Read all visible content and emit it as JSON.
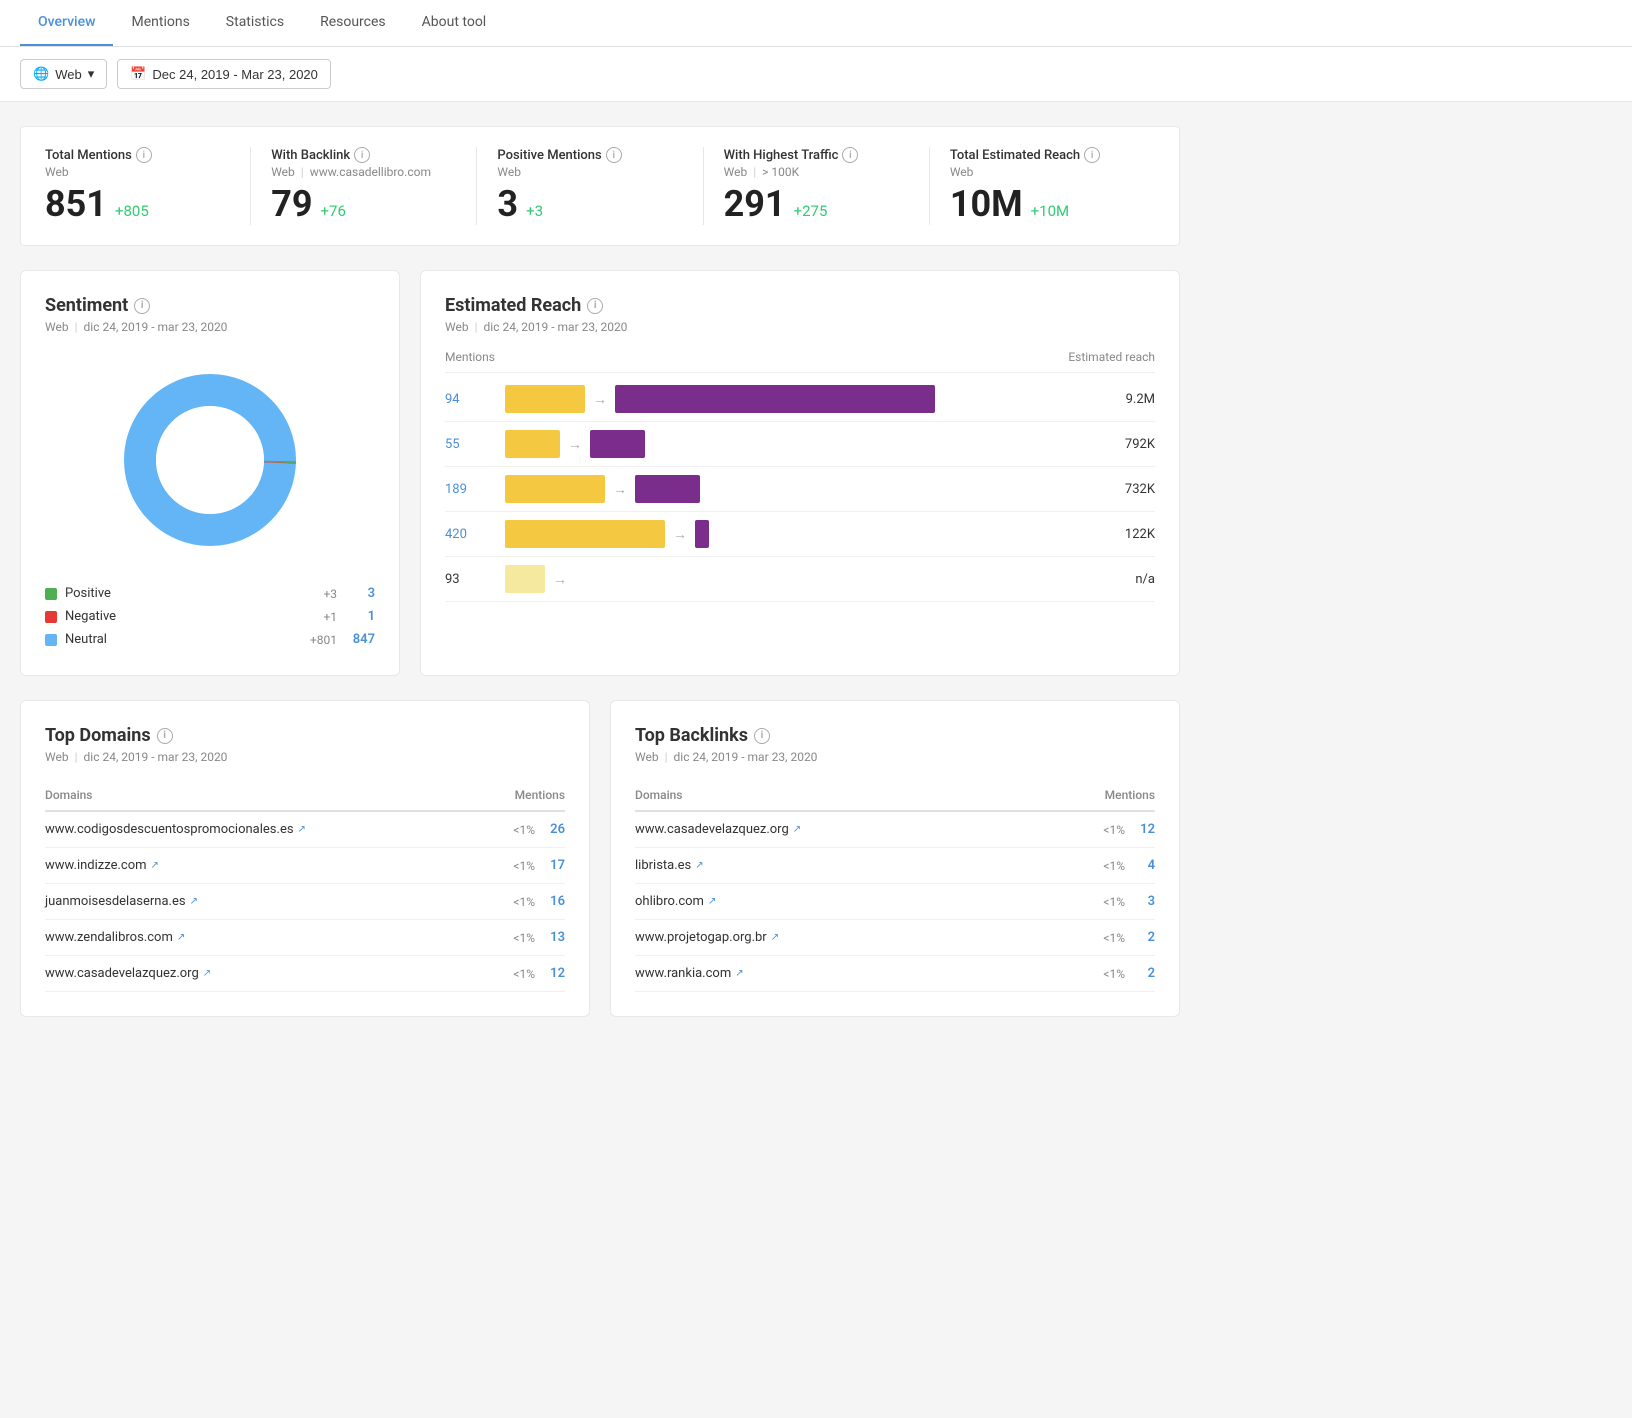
{
  "tabs": [
    {
      "label": "Overview",
      "active": true
    },
    {
      "label": "Mentions",
      "active": false
    },
    {
      "label": "Statistics",
      "active": false
    },
    {
      "label": "Resources",
      "active": false
    },
    {
      "label": "About tool",
      "active": false
    }
  ],
  "toolbar": {
    "filter_web": "Web",
    "filter_date": "Dec 24, 2019 - Mar 23, 2020"
  },
  "stats": [
    {
      "label": "Total Mentions",
      "info": "i",
      "sub1": "Web",
      "sub2": null,
      "sub3": null,
      "value": "851",
      "delta": "+805"
    },
    {
      "label": "With Backlink",
      "info": "i",
      "sub1": "Web",
      "sep": "|",
      "sub2": "www.casadellibro.com",
      "value": "79",
      "delta": "+76"
    },
    {
      "label": "Positive Mentions",
      "info": "i",
      "sub1": "Web",
      "value": "3",
      "delta": "+3"
    },
    {
      "label": "With Highest Traffic",
      "info": "i",
      "sub1": "Web",
      "sep": "|",
      "sub2": "> 100K",
      "value": "291",
      "delta": "+275"
    },
    {
      "label": "Total Estimated Reach",
      "info": "i",
      "sub1": "Web",
      "value": "10M",
      "delta": "+10M"
    }
  ],
  "sentiment": {
    "title": "Sentiment",
    "date_range": "dic 24, 2019 - mar 23, 2020",
    "source": "Web",
    "legend": [
      {
        "color": "#4caf50",
        "label": "Positive",
        "delta": "+3",
        "value": "3"
      },
      {
        "color": "#e53935",
        "label": "Negative",
        "delta": "+1",
        "value": "1"
      },
      {
        "color": "#64b5f6",
        "label": "Neutral",
        "delta": "+801",
        "value": "847"
      }
    ],
    "donut": {
      "positive_pct": 0.35,
      "negative_pct": 0.12,
      "neutral_pct": 99.53
    }
  },
  "estimated_reach": {
    "title": "Estimated Reach",
    "source": "Web",
    "date_range": "dic 24, 2019 - mar 23, 2020",
    "header_mentions": "Mentions",
    "header_reach": "Estimated reach",
    "rows": [
      {
        "mentions": "94",
        "yellow_width": 80,
        "purple_width": 320,
        "reach": "9.2M"
      },
      {
        "mentions": "55",
        "yellow_width": 55,
        "purple_width": 55,
        "reach": "792K"
      },
      {
        "mentions": "189",
        "yellow_width": 100,
        "purple_width": 65,
        "reach": "732K"
      },
      {
        "mentions": "420",
        "yellow_width": 160,
        "purple_width": 14,
        "reach": "122K"
      },
      {
        "mentions": "93",
        "yellow_width": 40,
        "purple_width": 0,
        "reach": "n/a"
      }
    ]
  },
  "top_domains": {
    "title": "Top Domains",
    "source": "Web",
    "date_range": "dic 24, 2019 - mar 23, 2020",
    "col_domains": "Domains",
    "col_mentions": "Mentions",
    "rows": [
      {
        "name": "www.codigosdescuentospromocionales.es",
        "pct": "<1%",
        "count": "26"
      },
      {
        "name": "www.indizze.com",
        "pct": "<1%",
        "count": "17"
      },
      {
        "name": "juanmoisesdelaserna.es",
        "pct": "<1%",
        "count": "16"
      },
      {
        "name": "www.zendalibros.com",
        "pct": "<1%",
        "count": "13"
      },
      {
        "name": "www.casadevelazquez.org",
        "pct": "<1%",
        "count": "12"
      }
    ]
  },
  "top_backlinks": {
    "title": "Top Backlinks",
    "source": "Web",
    "date_range": "dic 24, 2019 - mar 23, 2020",
    "col_domains": "Domains",
    "col_mentions": "Mentions",
    "rows": [
      {
        "name": "www.casadevelazquez.org",
        "pct": "<1%",
        "count": "12"
      },
      {
        "name": "librista.es",
        "pct": "<1%",
        "count": "4"
      },
      {
        "name": "ohlibro.com",
        "pct": "<1%",
        "count": "3"
      },
      {
        "name": "www.projetogap.org.br",
        "pct": "<1%",
        "count": "2"
      },
      {
        "name": "www.rankia.com",
        "pct": "<1%",
        "count": "2"
      }
    ]
  }
}
